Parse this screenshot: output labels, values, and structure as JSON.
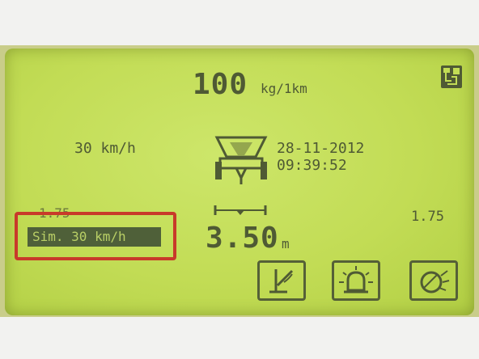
{
  "display": {
    "dose": {
      "value": "100",
      "unit": "kg/1km"
    },
    "speed": "30 km/h",
    "date": "28-11-2012",
    "time": "09:39:52",
    "left_value": "1.75",
    "right_value": "1.75",
    "working_width": {
      "value": "3.50",
      "unit": "m"
    },
    "sim_label": "Sim. 30 km/h"
  },
  "icons": {
    "corner": "exit-menu-icon",
    "spreader": "spreader-hopper-icon",
    "width": "working-width-icon",
    "buttons": [
      "spread-lever-icon",
      "beacon-light-icon",
      "worklight-icon"
    ]
  },
  "colors": {
    "lcd": "#c2dc55",
    "lcd_text": "#4f5a34",
    "highlight_border": "#c83a2a",
    "inverse_bar": "#4f6039"
  }
}
